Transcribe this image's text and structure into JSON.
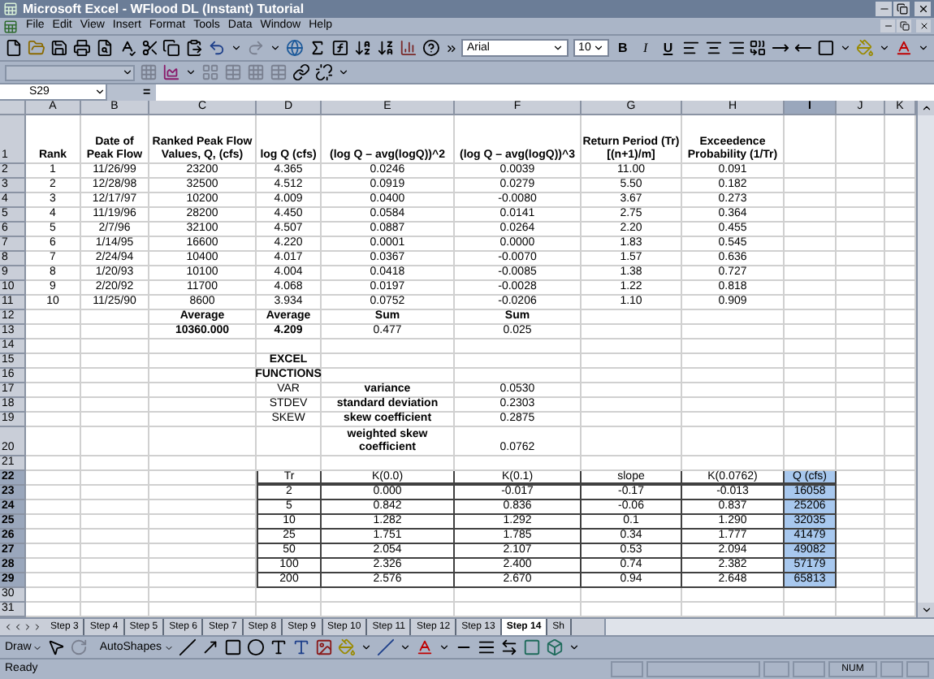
{
  "window": {
    "title": "Microsoft Excel - WFlood DL (Instant) Tutorial"
  },
  "menus": [
    "File",
    "Edit",
    "View",
    "Insert",
    "Format",
    "Tools",
    "Data",
    "Window",
    "Help"
  ],
  "formatting": {
    "font": "Arial",
    "size": "10",
    "styles": [
      "B",
      "I",
      "U"
    ]
  },
  "formula_bar": {
    "name_box": "S29",
    "equals": "="
  },
  "columns": [
    {
      "label": "A",
      "selected": false
    },
    {
      "label": "B",
      "selected": false
    },
    {
      "label": "C",
      "selected": false
    },
    {
      "label": "D",
      "selected": false
    },
    {
      "label": "E",
      "selected": false
    },
    {
      "label": "F",
      "selected": false
    },
    {
      "label": "G",
      "selected": false
    },
    {
      "label": "H",
      "selected": false
    },
    {
      "label": "I",
      "selected": true
    },
    {
      "label": "J",
      "selected": false
    },
    {
      "label": "K",
      "selected": false
    }
  ],
  "rows": [
    {
      "number": "1",
      "kind": "header",
      "selected": false,
      "cells": [
        {
          "text": "Rank",
          "bold": true
        },
        {
          "text": "Date of Peak Flow",
          "bold": true
        },
        {
          "text": "Ranked Peak Flow Values, Q, (cfs)",
          "bold": true
        },
        {
          "text": "log Q (cfs)",
          "bold": true
        },
        {
          "text": "(log Q – avg(logQ))^2",
          "bold": true
        },
        {
          "text": "(log Q – avg(logQ))^3",
          "bold": true
        },
        {
          "text": "Return Period (Tr) [(n+1)/m]",
          "bold": true
        },
        {
          "text": "Exceedence Probability (1/Tr)",
          "bold": true
        }
      ]
    },
    {
      "number": "2",
      "kind": "plain",
      "selected": false,
      "cells": [
        {
          "text": "1",
          "bold": false
        },
        {
          "text": "11/26/99",
          "bold": false
        },
        {
          "text": "23200",
          "bold": false
        },
        {
          "text": "4.365",
          "bold": false
        },
        {
          "text": "0.0246",
          "bold": false
        },
        {
          "text": "0.0039",
          "bold": false
        },
        {
          "text": "11.00",
          "bold": false
        },
        {
          "text": "0.091",
          "bold": false
        }
      ]
    },
    {
      "number": "3",
      "kind": "plain",
      "selected": false,
      "cells": [
        {
          "text": "2",
          "bold": false
        },
        {
          "text": "12/28/98",
          "bold": false
        },
        {
          "text": "32500",
          "bold": false
        },
        {
          "text": "4.512",
          "bold": false
        },
        {
          "text": "0.0919",
          "bold": false
        },
        {
          "text": "0.0279",
          "bold": false
        },
        {
          "text": "5.50",
          "bold": false
        },
        {
          "text": "0.182",
          "bold": false
        }
      ]
    },
    {
      "number": "4",
      "kind": "plain",
      "selected": false,
      "cells": [
        {
          "text": "3",
          "bold": false
        },
        {
          "text": "12/17/97",
          "bold": false
        },
        {
          "text": "10200",
          "bold": false
        },
        {
          "text": "4.009",
          "bold": false
        },
        {
          "text": "0.0400",
          "bold": false
        },
        {
          "text": "-0.0080",
          "bold": false
        },
        {
          "text": "3.67",
          "bold": false
        },
        {
          "text": "0.273",
          "bold": false
        }
      ]
    },
    {
      "number": "5",
      "kind": "plain",
      "selected": false,
      "cells": [
        {
          "text": "4",
          "bold": false
        },
        {
          "text": "11/19/96",
          "bold": false
        },
        {
          "text": "28200",
          "bold": false
        },
        {
          "text": "4.450",
          "bold": false
        },
        {
          "text": "0.0584",
          "bold": false
        },
        {
          "text": "0.0141",
          "bold": false
        },
        {
          "text": "2.75",
          "bold": false
        },
        {
          "text": "0.364",
          "bold": false
        }
      ]
    },
    {
      "number": "6",
      "kind": "plain",
      "selected": false,
      "cells": [
        {
          "text": "5",
          "bold": false
        },
        {
          "text": "2/7/96",
          "bold": false
        },
        {
          "text": "32100",
          "bold": false
        },
        {
          "text": "4.507",
          "bold": false
        },
        {
          "text": "0.0887",
          "bold": false
        },
        {
          "text": "0.0264",
          "bold": false
        },
        {
          "text": "2.20",
          "bold": false
        },
        {
          "text": "0.455",
          "bold": false
        }
      ]
    },
    {
      "number": "7",
      "kind": "plain",
      "selected": false,
      "cells": [
        {
          "text": "6",
          "bold": false
        },
        {
          "text": "1/14/95",
          "bold": false
        },
        {
          "text": "16600",
          "bold": false
        },
        {
          "text": "4.220",
          "bold": false
        },
        {
          "text": "0.0001",
          "bold": false
        },
        {
          "text": "0.0000",
          "bold": false
        },
        {
          "text": "1.83",
          "bold": false
        },
        {
          "text": "0.545",
          "bold": false
        }
      ]
    },
    {
      "number": "8",
      "kind": "plain",
      "selected": false,
      "cells": [
        {
          "text": "7",
          "bold": false
        },
        {
          "text": "2/24/94",
          "bold": false
        },
        {
          "text": "10400",
          "bold": false
        },
        {
          "text": "4.017",
          "bold": false
        },
        {
          "text": "0.0367",
          "bold": false
        },
        {
          "text": "-0.0070",
          "bold": false
        },
        {
          "text": "1.57",
          "bold": false
        },
        {
          "text": "0.636",
          "bold": false
        }
      ]
    },
    {
      "number": "9",
      "kind": "plain",
      "selected": false,
      "cells": [
        {
          "text": "8",
          "bold": false
        },
        {
          "text": "1/20/93",
          "bold": false
        },
        {
          "text": "10100",
          "bold": false
        },
        {
          "text": "4.004",
          "bold": false
        },
        {
          "text": "0.0418",
          "bold": false
        },
        {
          "text": "-0.0085",
          "bold": false
        },
        {
          "text": "1.38",
          "bold": false
        },
        {
          "text": "0.727",
          "bold": false
        }
      ]
    },
    {
      "number": "10",
      "kind": "plain",
      "selected": false,
      "cells": [
        {
          "text": "9",
          "bold": false
        },
        {
          "text": "2/20/92",
          "bold": false
        },
        {
          "text": "11700",
          "bold": false
        },
        {
          "text": "4.068",
          "bold": false
        },
        {
          "text": "0.0197",
          "bold": false
        },
        {
          "text": "-0.0028",
          "bold": false
        },
        {
          "text": "1.22",
          "bold": false
        },
        {
          "text": "0.818",
          "bold": false
        }
      ]
    },
    {
      "number": "11",
      "kind": "plain",
      "selected": false,
      "cells": [
        {
          "text": "10",
          "bold": false
        },
        {
          "text": "11/25/90",
          "bold": false
        },
        {
          "text": "8600",
          "bold": false
        },
        {
          "text": "3.934",
          "bold": false
        },
        {
          "text": "0.0752",
          "bold": false
        },
        {
          "text": "-0.0206",
          "bold": false
        },
        {
          "text": "1.10",
          "bold": false
        },
        {
          "text": "0.909",
          "bold": false
        }
      ]
    },
    {
      "number": "12",
      "kind": "plain",
      "selected": false,
      "cells": [
        null,
        null,
        {
          "text": "Average",
          "bold": true
        },
        {
          "text": "Average",
          "bold": true
        },
        {
          "text": "Sum",
          "bold": true
        },
        {
          "text": "Sum",
          "bold": true
        }
      ]
    },
    {
      "number": "13",
      "kind": "plain",
      "selected": false,
      "cells": [
        null,
        null,
        {
          "text": "10360.000",
          "bold": true
        },
        {
          "text": "4.209",
          "bold": true
        },
        {
          "text": "0.477",
          "bold": false
        },
        {
          "text": "0.025",
          "bold": false
        }
      ]
    },
    {
      "number": "14",
      "kind": "plain",
      "selected": false
    },
    {
      "number": "15",
      "kind": "plain",
      "selected": false,
      "cells": [
        null,
        null,
        null,
        {
          "text": "EXCEL",
          "bold": true
        }
      ]
    },
    {
      "number": "16",
      "kind": "plain",
      "selected": false,
      "cells": [
        null,
        null,
        null,
        {
          "text": "FUNCTIONS",
          "bold": true
        }
      ]
    },
    {
      "number": "17",
      "kind": "plain",
      "selected": false,
      "cells": [
        null,
        null,
        null,
        {
          "text": "VAR",
          "bold": false
        },
        {
          "text": "variance",
          "bold": true
        },
        {
          "text": "0.0530",
          "bold": false
        }
      ]
    },
    {
      "number": "18",
      "kind": "plain",
      "selected": false,
      "cells": [
        null,
        null,
        null,
        {
          "text": "STDEV",
          "bold": false
        },
        {
          "text": "standard deviation",
          "bold": true
        },
        {
          "text": "0.2303",
          "bold": false
        }
      ]
    },
    {
      "number": "19",
      "kind": "plain",
      "selected": false,
      "cells": [
        null,
        null,
        null,
        {
          "text": "SKEW",
          "bold": false
        },
        {
          "text": "skew coefficient",
          "bold": true
        },
        {
          "text": "0.2875",
          "bold": false
        }
      ]
    },
    {
      "number": "20",
      "kind": "tall",
      "selected": false,
      "cells": [
        null,
        null,
        null,
        null,
        {
          "text": "weighted skew coefficient",
          "bold": true
        },
        {
          "text": "0.0762",
          "bold": false
        }
      ]
    },
    {
      "number": "21",
      "kind": "plain",
      "selected": false
    },
    {
      "number": "22",
      "kind": "table_head",
      "selected": true,
      "cells": [
        null,
        null,
        null,
        {
          "text": "Tr",
          "bold": false
        },
        {
          "text": "K(0.0)",
          "bold": false
        },
        {
          "text": "K(0.1)",
          "bold": false
        },
        {
          "text": "slope",
          "bold": false
        },
        {
          "text": "K(0.0762)",
          "bold": false
        },
        {
          "text": "Q (cfs)",
          "bold": false
        }
      ]
    },
    {
      "number": "23",
      "kind": "table_body",
      "selected": true,
      "cells": [
        null,
        null,
        null,
        {
          "text": "2",
          "bold": false
        },
        {
          "text": "0.000",
          "bold": false
        },
        {
          "text": "-0.017",
          "bold": false
        },
        {
          "text": "-0.17",
          "bold": false
        },
        {
          "text": "-0.013",
          "bold": false
        },
        {
          "text": "16058",
          "bold": false
        }
      ]
    },
    {
      "number": "24",
      "kind": "table_body",
      "selected": true,
      "cells": [
        null,
        null,
        null,
        {
          "text": "5",
          "bold": false
        },
        {
          "text": "0.842",
          "bold": false
        },
        {
          "text": "0.836",
          "bold": false
        },
        {
          "text": "-0.06",
          "bold": false
        },
        {
          "text": "0.837",
          "bold": false
        },
        {
          "text": "25206",
          "bold": false
        }
      ]
    },
    {
      "number": "25",
      "kind": "table_body",
      "selected": true,
      "cells": [
        null,
        null,
        null,
        {
          "text": "10",
          "bold": false
        },
        {
          "text": "1.282",
          "bold": false
        },
        {
          "text": "1.292",
          "bold": false
        },
        {
          "text": "0.1",
          "bold": false
        },
        {
          "text": "1.290",
          "bold": false
        },
        {
          "text": "32035",
          "bold": false
        }
      ]
    },
    {
      "number": "26",
      "kind": "table_body",
      "selected": true,
      "cells": [
        null,
        null,
        null,
        {
          "text": "25",
          "bold": false
        },
        {
          "text": "1.751",
          "bold": false
        },
        {
          "text": "1.785",
          "bold": false
        },
        {
          "text": "0.34",
          "bold": false
        },
        {
          "text": "1.777",
          "bold": false
        },
        {
          "text": "41479",
          "bold": false
        }
      ]
    },
    {
      "number": "27",
      "kind": "table_body",
      "selected": true,
      "cells": [
        null,
        null,
        null,
        {
          "text": "50",
          "bold": false
        },
        {
          "text": "2.054",
          "bold": false
        },
        {
          "text": "2.107",
          "bold": false
        },
        {
          "text": "0.53",
          "bold": false
        },
        {
          "text": "2.094",
          "bold": false
        },
        {
          "text": "49082",
          "bold": false
        }
      ]
    },
    {
      "number": "28",
      "kind": "table_body",
      "selected": true,
      "cells": [
        null,
        null,
        null,
        {
          "text": "100",
          "bold": false
        },
        {
          "text": "2.326",
          "bold": false
        },
        {
          "text": "2.400",
          "bold": false
        },
        {
          "text": "0.74",
          "bold": false
        },
        {
          "text": "2.382",
          "bold": false
        },
        {
          "text": "57179",
          "bold": false
        }
      ]
    },
    {
      "number": "29",
      "kind": "table_body",
      "selected": true,
      "cells": [
        null,
        null,
        null,
        {
          "text": "200",
          "bold": false
        },
        {
          "text": "2.576",
          "bold": false
        },
        {
          "text": "2.670",
          "bold": false
        },
        {
          "text": "0.94",
          "bold": false
        },
        {
          "text": "2.648",
          "bold": false
        },
        {
          "text": "65813",
          "bold": false
        }
      ]
    },
    {
      "number": "30",
      "kind": "plain",
      "selected": false
    },
    {
      "number": "31",
      "kind": "plain",
      "selected": false
    }
  ],
  "sheet_tabs": [
    {
      "label": "Step 3",
      "selected": false
    },
    {
      "label": "Step 4",
      "selected": false
    },
    {
      "label": "Step 5",
      "selected": false
    },
    {
      "label": "Step 6",
      "selected": false
    },
    {
      "label": "Step 7",
      "selected": false
    },
    {
      "label": "Step 8",
      "selected": false
    },
    {
      "label": "Step 9",
      "selected": false
    },
    {
      "label": "Step 10",
      "selected": false
    },
    {
      "label": "Step 11",
      "selected": false
    },
    {
      "label": "Step 12",
      "selected": false
    },
    {
      "label": "Step 13",
      "selected": false
    },
    {
      "label": "Step 14",
      "selected": true
    },
    {
      "label": "Sh",
      "selected": false
    }
  ],
  "drawing_toolbar": {
    "draw": "Draw",
    "autoshapes": "AutoShapes"
  },
  "status_bar": {
    "status": "Ready",
    "indicator": "NUM"
  }
}
